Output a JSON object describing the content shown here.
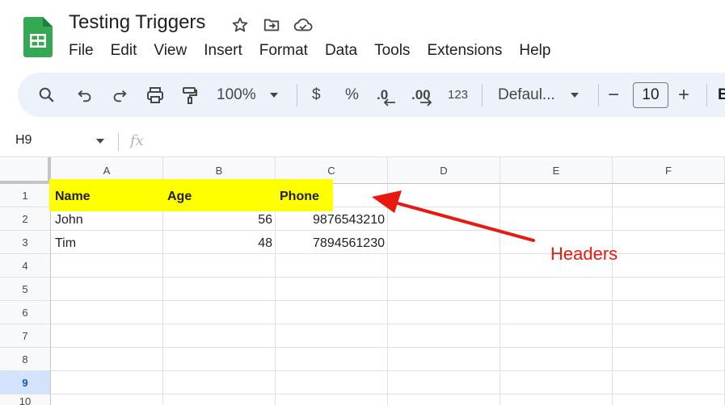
{
  "doc": {
    "title": "Testing Triggers",
    "icons": [
      "star-icon",
      "move-to-folder-icon",
      "cloud-saved-icon"
    ]
  },
  "menu": [
    "File",
    "Edit",
    "View",
    "Insert",
    "Format",
    "Data",
    "Tools",
    "Extensions",
    "Help"
  ],
  "toolbar": {
    "zoom": "100%",
    "currency": "$",
    "percent": "%",
    "decrease_decimal": ".0",
    "increase_decimal": ".00",
    "number_format": "123",
    "font": "Defaul...",
    "font_size": "10",
    "minus": "−",
    "plus": "+",
    "bold": "B"
  },
  "formula_bar": {
    "cell_ref": "H9",
    "fx": "fx",
    "value": ""
  },
  "sheet": {
    "columns": [
      "A",
      "B",
      "C",
      "D",
      "E",
      "F"
    ],
    "rows": [
      "1",
      "2",
      "3",
      "4",
      "5",
      "6",
      "7",
      "8",
      "9",
      "10"
    ],
    "selected_row": "9",
    "data": {
      "A1": "Name",
      "B1": "Age",
      "C1": "Phone",
      "A2": "John",
      "B2": "56",
      "C2": "9876543210",
      "A3": "Tim",
      "B3": "48",
      "C3": "7894561230"
    },
    "highlight_color": "#ffff00"
  },
  "annotation": {
    "label": "Headers",
    "color": "#e8190f"
  }
}
